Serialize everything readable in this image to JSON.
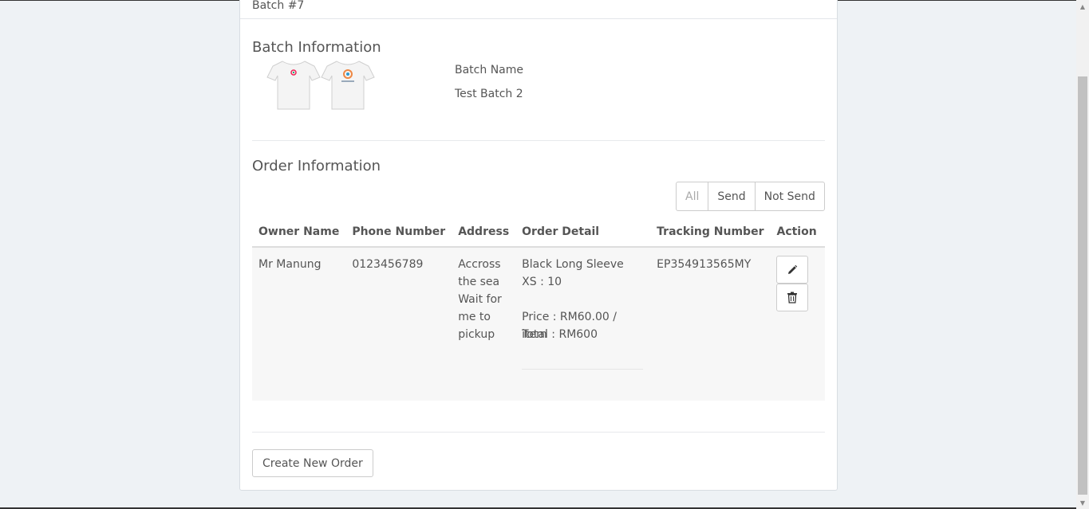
{
  "header": {
    "batch_title": "Batch #7"
  },
  "batch_info": {
    "title": "Batch Information",
    "name_label": "Batch Name",
    "name_value": "Test Batch 2"
  },
  "order_info": {
    "title": "Order Information",
    "filters": [
      "All",
      "Send",
      "Not Send"
    ],
    "columns": [
      "Owner Name",
      "Phone Number",
      "Address",
      "Order Detail",
      "Tracking Number",
      "Action"
    ],
    "row": {
      "owner": "Mr Manung",
      "phone": "0123456789",
      "address": "Accross the sea Wait for me to pickup",
      "detail_item": "Black Long Sleeve",
      "detail_size": "XS : 10",
      "detail_price": "Price : RM60.00 / item",
      "detail_total": "Total : RM600",
      "tracking": "EP354913565MY"
    }
  },
  "footer": {
    "create_label": "Create New Order"
  },
  "icons": {
    "edit": "pencil-icon",
    "delete": "trash-icon",
    "shirt": "tshirt-icon"
  }
}
